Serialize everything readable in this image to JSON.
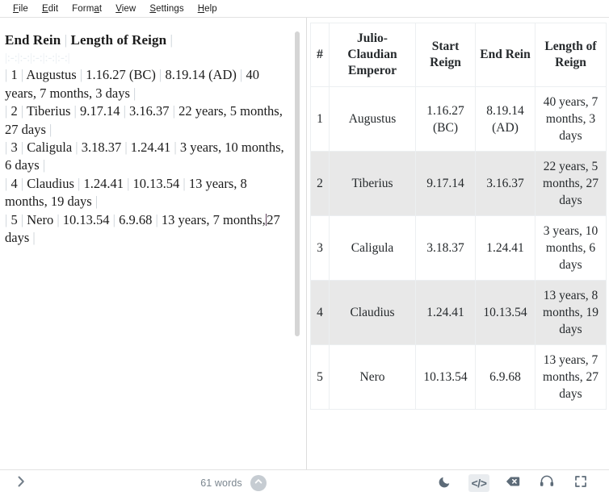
{
  "menubar": {
    "items": [
      {
        "pre": "",
        "acc": "F",
        "post": "ile",
        "name": "menu-file"
      },
      {
        "pre": "",
        "acc": "E",
        "post": "dit",
        "name": "menu-edit"
      },
      {
        "pre": "Form",
        "acc": "a",
        "post": "t",
        "name": "menu-format"
      },
      {
        "pre": "",
        "acc": "V",
        "post": "iew",
        "name": "menu-view"
      },
      {
        "pre": "",
        "acc": "S",
        "post": "ettings",
        "name": "menu-settings"
      },
      {
        "pre": "",
        "acc": "H",
        "post": "elp",
        "name": "menu-help"
      }
    ]
  },
  "editor": {
    "header_line": "End Rein | Length of Reign |",
    "separator_line": "|:-:|:-:|:-:|:-:|:-:|",
    "rows": [
      "| 1 | Augustus | 1.16.27 (BC) | 8.19.14 (AD) | 40 years, 7 months, 3 days |",
      "| 2 | Tiberius | 9.17.14 | 3.16.37 | 22 years, 5 months, 27 days |",
      "| 3 | Caligula | 3.18.37 | 1.24.41 | 3 years, 10 months, 6 days |",
      "| 4 | Claudius | 1.24.41 | 10.13.54 | 13 years, 8 months, 19 days |",
      "| 5 | Nero | 10.13.54 | 6.9.68 | 13 years, 7 months, 27 days |"
    ],
    "header_parts": {
      "t1": "End Rein",
      "p1": "|",
      "t2": "Length of Reign",
      "p2": "|"
    },
    "line1": {
      "p0": "|",
      "a": "1",
      "p1": "|",
      "b": "Augustus",
      "p2": "|",
      "c": "1.16.27 (BC)",
      "p3": "|",
      "d": "8.19.14 (AD)",
      "p4": "|",
      "e": "40 years, 7 months, 3 days",
      "p5": "|"
    },
    "line2": {
      "p0": "|",
      "a": "2",
      "p1": "|",
      "b": "Tiberius",
      "p2": "|",
      "c": "9.17.14",
      "p3": "|",
      "d": "3.16.37",
      "p4": "|",
      "e": "22 years, 5 months, 27 days",
      "p5": "|"
    },
    "line3": {
      "p0": "|",
      "a": "3",
      "p1": "|",
      "b": "Caligula",
      "p2": "|",
      "c": "3.18.37",
      "p3": "|",
      "d": "1.24.41",
      "p4": "|",
      "e": "3 years, 10 months, 6 days",
      "p5": "|"
    },
    "line4": {
      "p0": "|",
      "a": "4",
      "p1": "|",
      "b": "Claudius",
      "p2": "|",
      "c": "1.24.41",
      "p3": "|",
      "d": "10.13.54",
      "p4": "|",
      "e": "13 years, 8 months, 19 days",
      "p5": "|"
    },
    "line5": {
      "p0": "|",
      "a": "5",
      "p1": "|",
      "b": "Nero",
      "p2": "|",
      "c": "10.13.54",
      "p3": "|",
      "d": "6.9.68",
      "p4": "|",
      "e_before": "13 years, 7 months,",
      "e_after": "27 days",
      "p5": "|"
    }
  },
  "preview": {
    "headers": [
      "#",
      "Julio-Claudian Emperor",
      "Start Reign",
      "End Rein",
      "Length of Reign"
    ],
    "rows": [
      [
        "1",
        "Augustus",
        "1.16.27 (BC)",
        "8.19.14 (AD)",
        "40 years, 7 months, 3 days"
      ],
      [
        "2",
        "Tiberius",
        "9.17.14",
        "3.16.37",
        "22 years, 5 months, 27 days"
      ],
      [
        "3",
        "Caligula",
        "3.18.37",
        "1.24.41",
        "3 years, 10 months, 6 days"
      ],
      [
        "4",
        "Claudius",
        "1.24.41",
        "10.13.54",
        "13 years, 8 months, 19 days"
      ],
      [
        "5",
        "Nero",
        "10.13.54",
        "6.9.68",
        "13 years, 7 months, 27 days"
      ]
    ]
  },
  "statusbar": {
    "expand_icon": "chevron-right-icon",
    "word_count": "61 words",
    "scroll_top_icon": "chevron-up-circle-icon",
    "buttons": [
      {
        "name": "dark-mode-icon",
        "glyph": "moon",
        "active": false
      },
      {
        "name": "source-code-icon",
        "glyph": "code",
        "active": true
      },
      {
        "name": "clear-text-icon",
        "glyph": "backspace",
        "active": false
      },
      {
        "name": "read-aloud-icon",
        "glyph": "headphones",
        "active": false
      },
      {
        "name": "fullscreen-icon",
        "glyph": "fullscreen",
        "active": false
      }
    ]
  },
  "colors": {
    "accent": "#5d6b78",
    "alt_row": "#e8e8e8",
    "pipe": "#c9d0d6",
    "caret": "#5b3a56"
  }
}
